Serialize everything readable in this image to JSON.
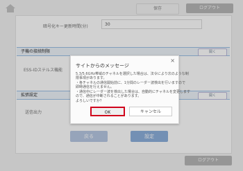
{
  "header": {
    "save_label": "保存",
    "logout_label": "ログアウト"
  },
  "settings": {
    "rekey_label": "暗号化キー更新時間(分)",
    "rekey_value": "30",
    "child_section_title": "子機の接続制限",
    "toggle_label": "開く",
    "ess_label": "ESS-IDステルス機能",
    "advanced_section_title": "拡張設定",
    "tx_power_label": "送信出力"
  },
  "footer": {
    "back_label": "戻る",
    "apply_label": "設定"
  },
  "bottom": {
    "logout_label": "ログアウト"
  },
  "dialog": {
    "title": "サイトからのメッセージ",
    "close_glyph": "×",
    "lines": [
      "5.3/5.6GHz帯域のチャネルを選択した場合は、法令により次のような制",
      "限事項があります。",
      "・各チャネルの通信開始前に、1分間のレーダー波検出を行いますので",
      "即時通信を行えません。",
      "・通信中にレーダー波を検出した場合は、自動的にチャネルを変更します",
      "ので、通信が中断されることがあります。",
      "よろしいですか？"
    ],
    "ok_label": "OK",
    "cancel_label": "キャンセル"
  }
}
